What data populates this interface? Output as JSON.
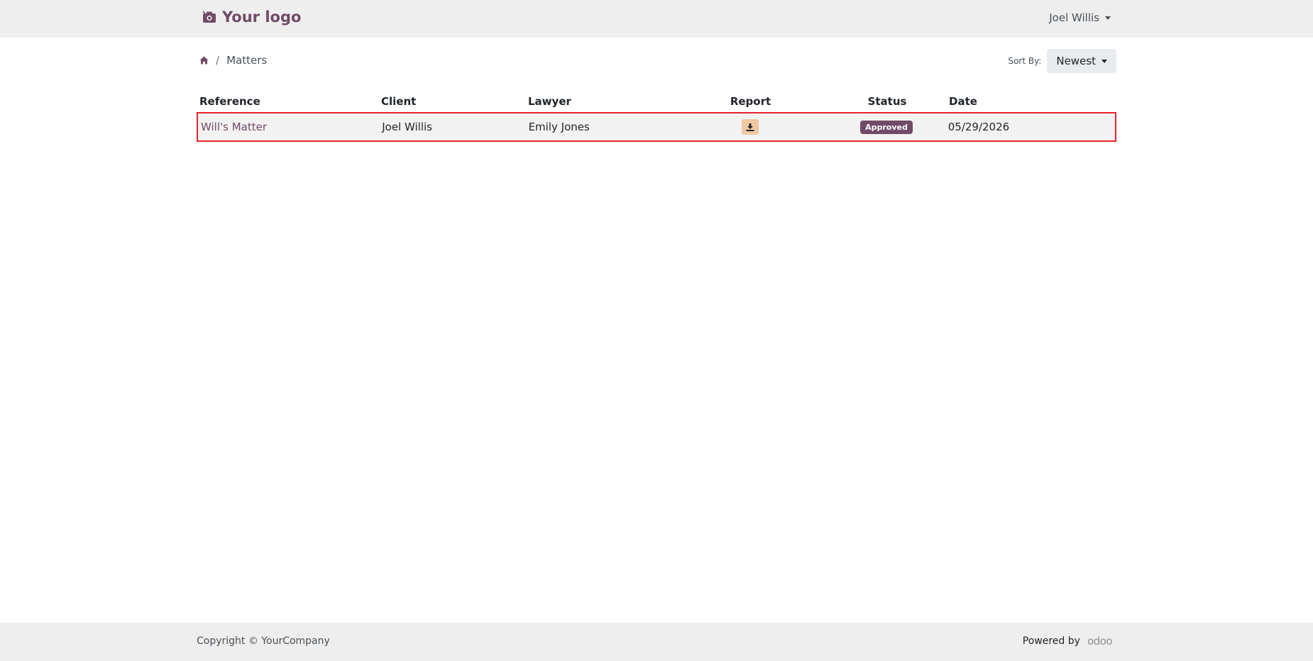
{
  "header": {
    "logo_text": "Your logo",
    "user_name": "Joel Willis"
  },
  "breadcrumb": {
    "current": "Matters",
    "separator": "/"
  },
  "sort": {
    "label": "Sort By:",
    "selected": "Newest"
  },
  "table": {
    "columns": [
      "Reference",
      "Client",
      "Lawyer",
      "Report",
      "Status",
      "Date"
    ],
    "rows": [
      {
        "reference": "Will's Matter",
        "client": "Joel Willis",
        "lawyer": "Emily Jones",
        "report_icon": "download-icon",
        "status": "Approved",
        "date": "05/29/2026"
      }
    ]
  },
  "footer": {
    "copyright": "Copyright © YourCompany",
    "powered_by": "Powered by",
    "brand": "odoo"
  },
  "colors": {
    "brand": "#714B67",
    "highlight_border": "#e8232b",
    "report_button": "#f0c9a2"
  }
}
